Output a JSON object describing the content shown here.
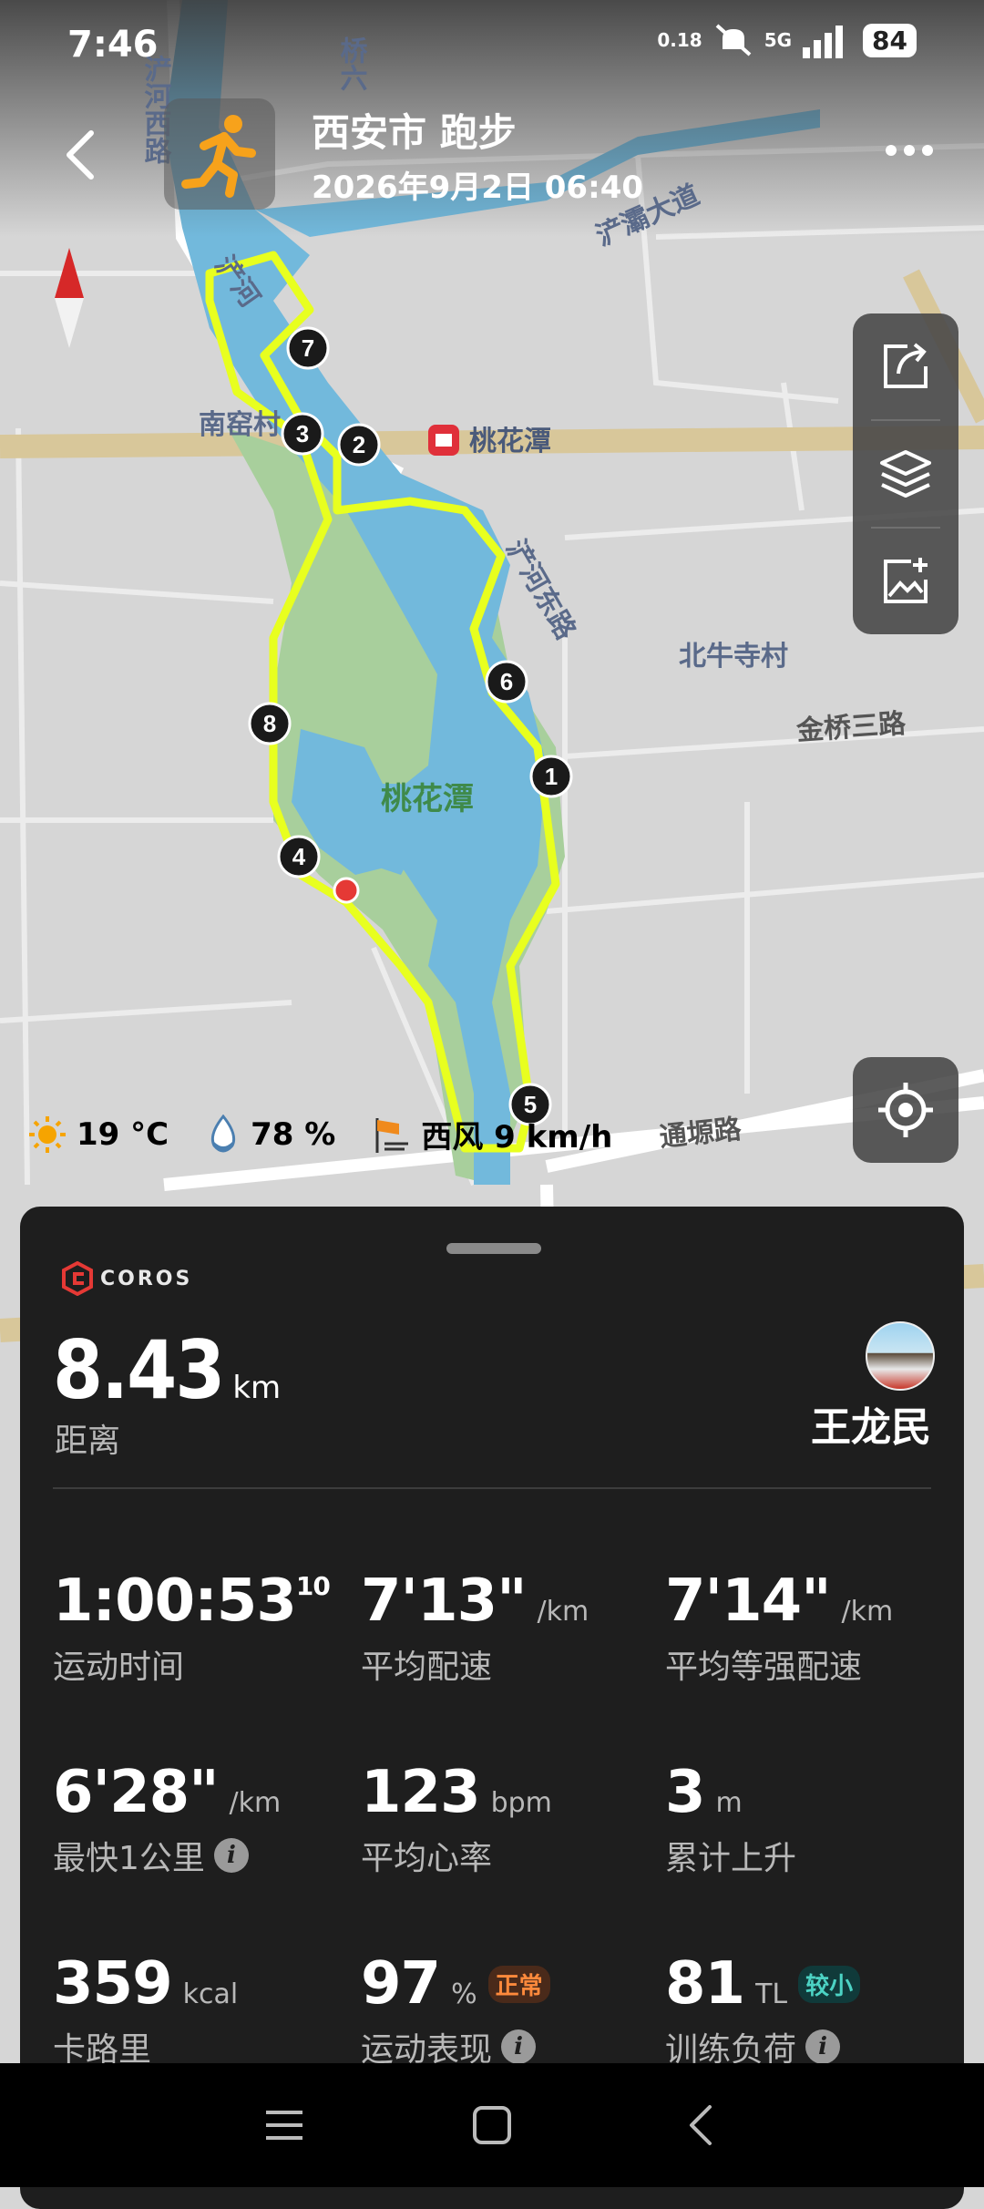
{
  "status": {
    "time": "7:46",
    "speed": "0.18",
    "network": "5G",
    "battery": "84"
  },
  "header": {
    "title": "西安市 跑步",
    "datetime": "2026年9月2日 06:40",
    "back_icon": "back-arrow-icon",
    "activity_icon": "running-icon",
    "more_icon": "more-dots-icon"
  },
  "map": {
    "labels": {
      "chan_he_xi_lu": "浐河西路",
      "qiao_liu": "桥六",
      "chan_ba_da_dao": "浐灞大道",
      "chan_he": "浐河",
      "nan_yao_cun": "南窑村",
      "tao_hua_tan_station": "桃花潭",
      "chan_he_dong_lu": "浐河东路",
      "bei_niu_si_cun": "北牛寺村",
      "jin_qiao_san_lu": "金桥三路",
      "tao_hua_tan_park": "桃花潭",
      "tong_yuan_lu": "通塬路"
    },
    "km_markers": [
      "1",
      "2",
      "3",
      "4",
      "5",
      "6",
      "7",
      "8"
    ],
    "tools": [
      "share-icon",
      "layers-icon",
      "add-photo-icon"
    ],
    "locate_icon": "locate-icon",
    "colors": {
      "route": "#e8ff1f",
      "water": "#72b9dc",
      "park": "#a8cf9c",
      "road": "#d8c79a",
      "land": "#d6d6d6"
    }
  },
  "weather": {
    "temp": "19 °C",
    "humidity": "78 %",
    "wind": "西风 9 km/h"
  },
  "card": {
    "brand": "COROS",
    "distance": {
      "value": "8.43",
      "unit": "km",
      "label": "距离"
    },
    "user": {
      "name": "王龙民"
    },
    "metrics": [
      {
        "value": "1:00:53",
        "sup": "10",
        "unit": "",
        "label": "运动时间"
      },
      {
        "value": "7'13\"",
        "unit": "/km",
        "label": "平均配速"
      },
      {
        "value": "7'14\"",
        "unit": "/km",
        "label": "平均等强配速"
      },
      {
        "value": "6'28\"",
        "unit": "/km",
        "label": "最快1公里"
      },
      {
        "value": "123",
        "unit": "bpm",
        "label": "平均心率"
      },
      {
        "value": "3",
        "unit": "m",
        "label": "累计上升"
      },
      {
        "value": "359",
        "unit": "kcal",
        "label": "卡路里"
      },
      {
        "value": "97",
        "unit": "%",
        "badge": "正常",
        "label": "运动表现"
      },
      {
        "value": "81",
        "unit": "TL",
        "badge": "较小",
        "label": "训练负荷"
      }
    ],
    "info_glyph": "i"
  },
  "navbar": {
    "menu_icon": "menu-icon",
    "home_icon": "home-square-icon",
    "back_icon": "nav-back-icon"
  }
}
